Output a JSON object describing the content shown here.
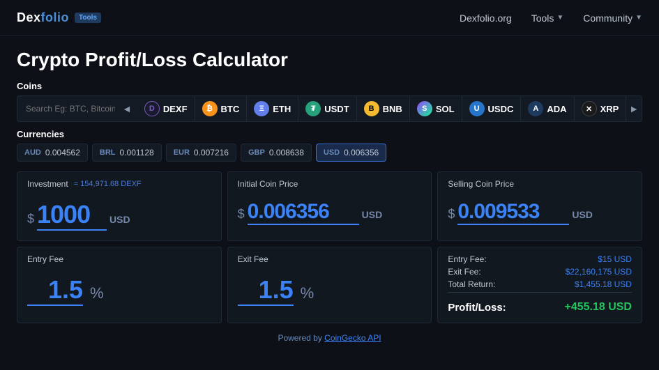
{
  "header": {
    "logo": "Dexfolio",
    "logo_accent": "Dex",
    "tools_badge": "Tools",
    "nav": [
      {
        "label": "Dexfolio.org",
        "has_dropdown": false
      },
      {
        "label": "Tools",
        "has_dropdown": true
      },
      {
        "label": "Community",
        "has_dropdown": true
      }
    ]
  },
  "page": {
    "title": "Crypto Profit/Loss Calculator"
  },
  "coins": {
    "section_label": "Coins",
    "search_placeholder": "Search Eg: BTC, Bitcoin, etc.",
    "items": [
      {
        "symbol": "DEXF",
        "icon_class": "icon-dexf",
        "icon_char": "D"
      },
      {
        "symbol": "BTC",
        "icon_class": "icon-btc",
        "icon_char": "₿"
      },
      {
        "symbol": "ETH",
        "icon_class": "icon-eth",
        "icon_char": "Ξ"
      },
      {
        "symbol": "USDT",
        "icon_class": "icon-usdt",
        "icon_char": "₮"
      },
      {
        "symbol": "BNB",
        "icon_class": "icon-bnb",
        "icon_char": "B"
      },
      {
        "symbol": "SOL",
        "icon_class": "icon-sol",
        "icon_char": "S"
      },
      {
        "symbol": "USDC",
        "icon_class": "icon-usdc",
        "icon_char": "U"
      },
      {
        "symbol": "ADA",
        "icon_class": "icon-ada",
        "icon_char": "A"
      },
      {
        "symbol": "XRP",
        "icon_class": "icon-xrp",
        "icon_char": "✕"
      }
    ]
  },
  "currencies": {
    "section_label": "Currencies",
    "items": [
      {
        "code": "AUD",
        "value": "0.004562",
        "active": false
      },
      {
        "code": "BRL",
        "value": "0.001128",
        "active": false
      },
      {
        "code": "EUR",
        "value": "0.007216",
        "active": false
      },
      {
        "code": "GBP",
        "value": "0.008638",
        "active": false
      },
      {
        "code": "USD",
        "value": "0.006356",
        "active": true
      }
    ]
  },
  "calculator": {
    "investment": {
      "label": "Investment",
      "sub_label": "= 154,971.68 DEXF",
      "dollar_sign": "$",
      "value": "1000",
      "currency": "USD"
    },
    "initial_price": {
      "label": "Initial Coin Price",
      "dollar_sign": "$",
      "value": "0.006356",
      "currency": "USD"
    },
    "selling_price": {
      "label": "Selling Coin Price",
      "dollar_sign": "$",
      "value": "0.009533",
      "currency": "USD"
    },
    "entry_fee": {
      "label": "Entry Fee",
      "value": "1.5",
      "unit": "%"
    },
    "exit_fee": {
      "label": "Exit Fee",
      "value": "1.5",
      "unit": "%"
    },
    "summary": {
      "entry_fee_label": "Entry Fee:",
      "entry_fee_value": "$15 USD",
      "exit_fee_label": "Exit Fee:",
      "exit_fee_value": "$22,160,175 USD",
      "total_return_label": "Total Return:",
      "total_return_value": "$1,455.18 USD",
      "profit_loss_label": "Profit/Loss:",
      "profit_loss_value": "+455.18 USD"
    }
  },
  "footer": {
    "text": "Powered by ",
    "link_text": "CoinGecko API"
  }
}
